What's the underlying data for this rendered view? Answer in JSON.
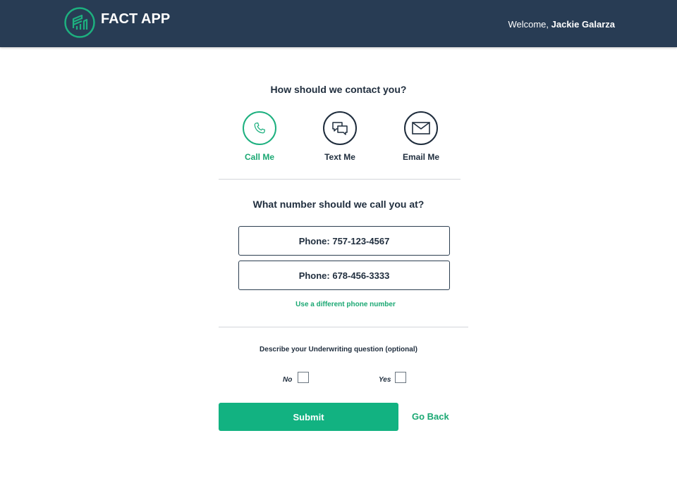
{
  "header": {
    "app_name": "FACT APP",
    "welcome_prefix": "Welcome, ",
    "user_name": "Jackie Galarza",
    "logo_icon": "building-chart-logo-icon",
    "background_color": "#283c54",
    "accent_color": "#1db07f"
  },
  "contact": {
    "question": "How should we contact you?",
    "options": [
      {
        "label": "Call Me",
        "icon": "phone-icon",
        "selected": true
      },
      {
        "label": "Text Me",
        "icon": "chat-bubbles-icon",
        "selected": false
      },
      {
        "label": "Email Me",
        "icon": "envelope-icon",
        "selected": false
      }
    ]
  },
  "phone": {
    "question": "What number should we call you at?",
    "numbers": [
      "Phone: 757-123-4567",
      "Phone: 678-456-3333"
    ],
    "different_link": "Use a different phone number"
  },
  "underwriting": {
    "label": "Describe your Underwriting question (optional)",
    "no_label": "No",
    "yes_label": "Yes",
    "no_checked": false,
    "yes_checked": false
  },
  "actions": {
    "submit_label": "Submit",
    "go_back_label": "Go Back",
    "submit_color": "#12b281"
  }
}
